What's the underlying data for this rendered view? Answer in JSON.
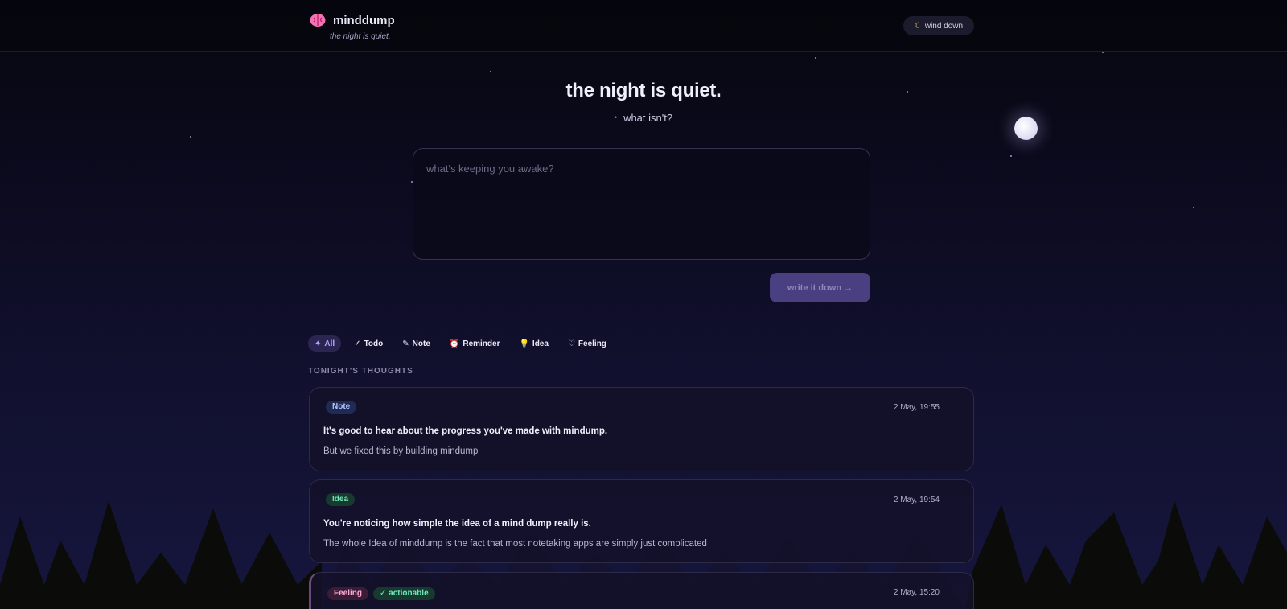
{
  "header": {
    "brand_name": "minddump",
    "brand_tagline": "the night is quiet.",
    "wind_down_label": "wind down",
    "wind_down_icon": "moon-icon"
  },
  "hero": {
    "title": "the night is quiet.",
    "subtitle": "what isn't?"
  },
  "composer": {
    "placeholder": "what's keeping you awake?",
    "submit_label": "write it down →"
  },
  "filters": [
    {
      "icon": "sparkle-icon",
      "glyph": "✦",
      "label": "All",
      "active": true
    },
    {
      "icon": "check-icon",
      "glyph": "✓",
      "label": "Todo",
      "active": false
    },
    {
      "icon": "pencil-icon",
      "glyph": "✎",
      "label": "Note",
      "active": false
    },
    {
      "icon": "alarm-clock-icon",
      "glyph": "⏰",
      "label": "Reminder",
      "active": false
    },
    {
      "icon": "lightbulb-icon",
      "glyph": "💡",
      "label": "Idea",
      "active": false
    },
    {
      "icon": "heart-icon",
      "glyph": "♡",
      "label": "Feeling",
      "active": false
    }
  ],
  "section_title": "TONIGHT'S THOUGHTS",
  "thoughts": [
    {
      "category": "Note",
      "timestamp": "2 May, 19:55",
      "title": "It's good to hear about the progress you've made with mindump.",
      "body": "But we fixed this by building mindump"
    },
    {
      "category": "Idea",
      "timestamp": "2 May, 19:54",
      "title": "You're noticing how simple the idea of a mind dump really is.",
      "body": "The whole Idea of minddump is the fact that most notetaking apps are simply just complicated"
    },
    {
      "category": "Feeling",
      "extra_badge": "✓ actionable",
      "timestamp": "2 May, 15:20"
    }
  ],
  "colors": {
    "accent": "#4a4081",
    "active_filter_bg": "#2b2552",
    "note_badge": "#1f2a55",
    "idea_badge": "#163a2f",
    "feeling_badge": "#3a1c36"
  }
}
